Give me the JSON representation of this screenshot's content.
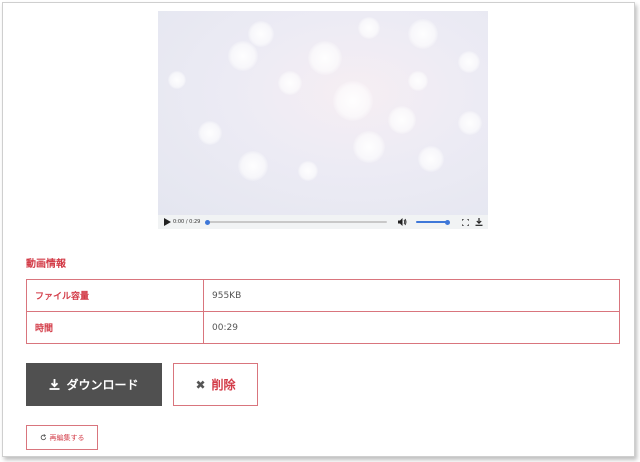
{
  "video": {
    "current_time": "0:00",
    "separator": " / ",
    "duration": "0:29",
    "progress_fraction": 0.0,
    "volume_fraction": 1.0,
    "icons": [
      "play-icon",
      "volume-icon",
      "fullscreen-icon",
      "download-icon"
    ]
  },
  "info": {
    "section_title": "動画情報",
    "rows": [
      {
        "label": "ファイル容量",
        "value": "955KB"
      },
      {
        "label": "時間",
        "value": "00:29"
      }
    ]
  },
  "actions": {
    "download_label": "ダウンロード",
    "delete_label": "削除",
    "reedit_label": "再編集する"
  },
  "colors": {
    "accent": "#d33c48",
    "border": "#d9757d",
    "download_bg": "#505050",
    "player_accent": "#3e77d8"
  }
}
